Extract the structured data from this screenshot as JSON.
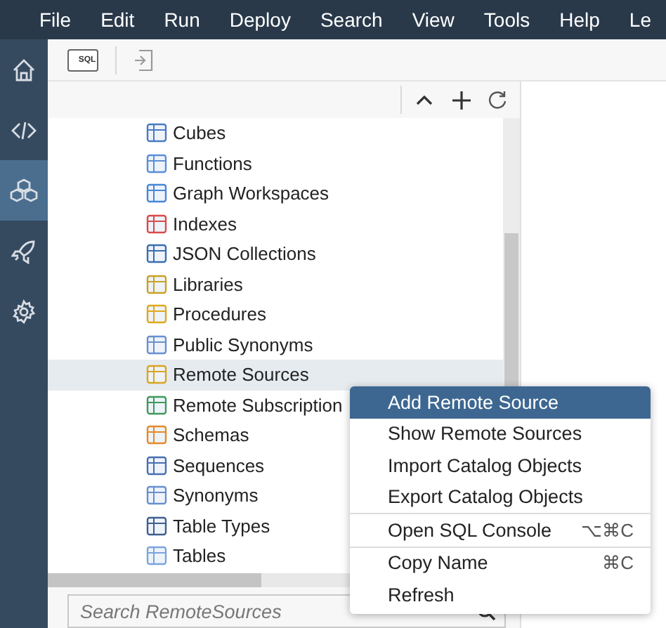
{
  "menubar": {
    "items": [
      "File",
      "Edit",
      "Run",
      "Deploy",
      "Search",
      "View",
      "Tools",
      "Help",
      "Le"
    ]
  },
  "sidebar": {
    "items": [
      {
        "selected": false
      },
      {
        "selected": false
      },
      {
        "selected": true
      },
      {
        "selected": false
      },
      {
        "selected": false
      }
    ]
  },
  "toolbar": {
    "sql_button_label": "SQL"
  },
  "tree": {
    "items": [
      {
        "label": "Cubes",
        "selected": false
      },
      {
        "label": "Functions",
        "selected": false
      },
      {
        "label": "Graph Workspaces",
        "selected": false
      },
      {
        "label": "Indexes",
        "selected": false
      },
      {
        "label": "JSON Collections",
        "selected": false
      },
      {
        "label": "Libraries",
        "selected": false
      },
      {
        "label": "Procedures",
        "selected": false
      },
      {
        "label": "Public Synonyms",
        "selected": false
      },
      {
        "label": "Remote Sources",
        "selected": true
      },
      {
        "label": "Remote Subscription",
        "selected": false
      },
      {
        "label": "Schemas",
        "selected": false
      },
      {
        "label": "Sequences",
        "selected": false
      },
      {
        "label": "Synonyms",
        "selected": false
      },
      {
        "label": "Table Types",
        "selected": false
      },
      {
        "label": "Tables",
        "selected": false
      }
    ]
  },
  "search": {
    "placeholder": "Search RemoteSources"
  },
  "context_menu": {
    "items": [
      {
        "label": "Add Remote Source",
        "selected": true,
        "separator_before": false
      },
      {
        "label": "Show Remote Sources",
        "selected": false,
        "separator_before": false
      },
      {
        "label": "Import Catalog Objects",
        "selected": false,
        "separator_before": false
      },
      {
        "label": "Export Catalog Objects",
        "selected": false,
        "separator_before": false
      },
      {
        "label": "Open SQL Console",
        "shortcut": "⌥⌘C",
        "selected": false,
        "separator_before": true
      },
      {
        "label": "Copy Name",
        "shortcut": "⌘C",
        "selected": false,
        "separator_before": true
      },
      {
        "label": "Refresh",
        "selected": false,
        "separator_before": false
      }
    ]
  }
}
